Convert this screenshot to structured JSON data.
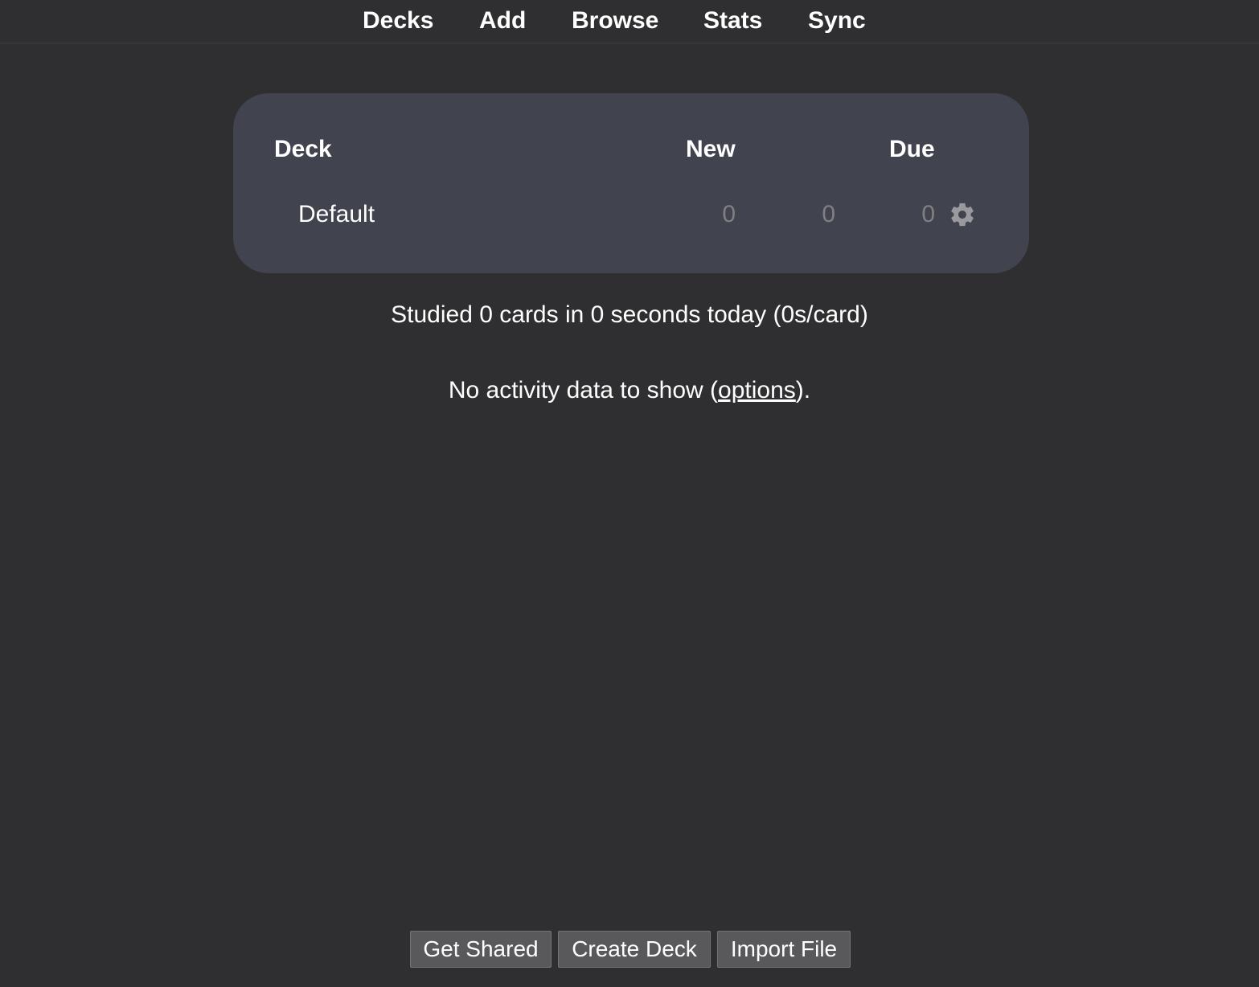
{
  "nav": {
    "decks": "Decks",
    "add": "Add",
    "browse": "Browse",
    "stats": "Stats",
    "sync": "Sync"
  },
  "deck_table": {
    "headers": {
      "deck": "Deck",
      "new": "New",
      "due": "Due"
    },
    "rows": [
      {
        "name": "Default",
        "new": "0",
        "learn": "0",
        "due": "0",
        "options_icon": "gear-icon"
      }
    ]
  },
  "stats": {
    "studied_text": "Studied 0 cards in 0 seconds today (0s/card)"
  },
  "activity": {
    "prefix": "No activity data to show (",
    "link": "options",
    "suffix": ")."
  },
  "buttons": {
    "get_shared": "Get Shared",
    "create_deck": "Create Deck",
    "import_file": "Import File"
  },
  "colors": {
    "background": "#2f2f31",
    "card": "#41444f",
    "count_text": "#808083",
    "button": "#59595b"
  }
}
